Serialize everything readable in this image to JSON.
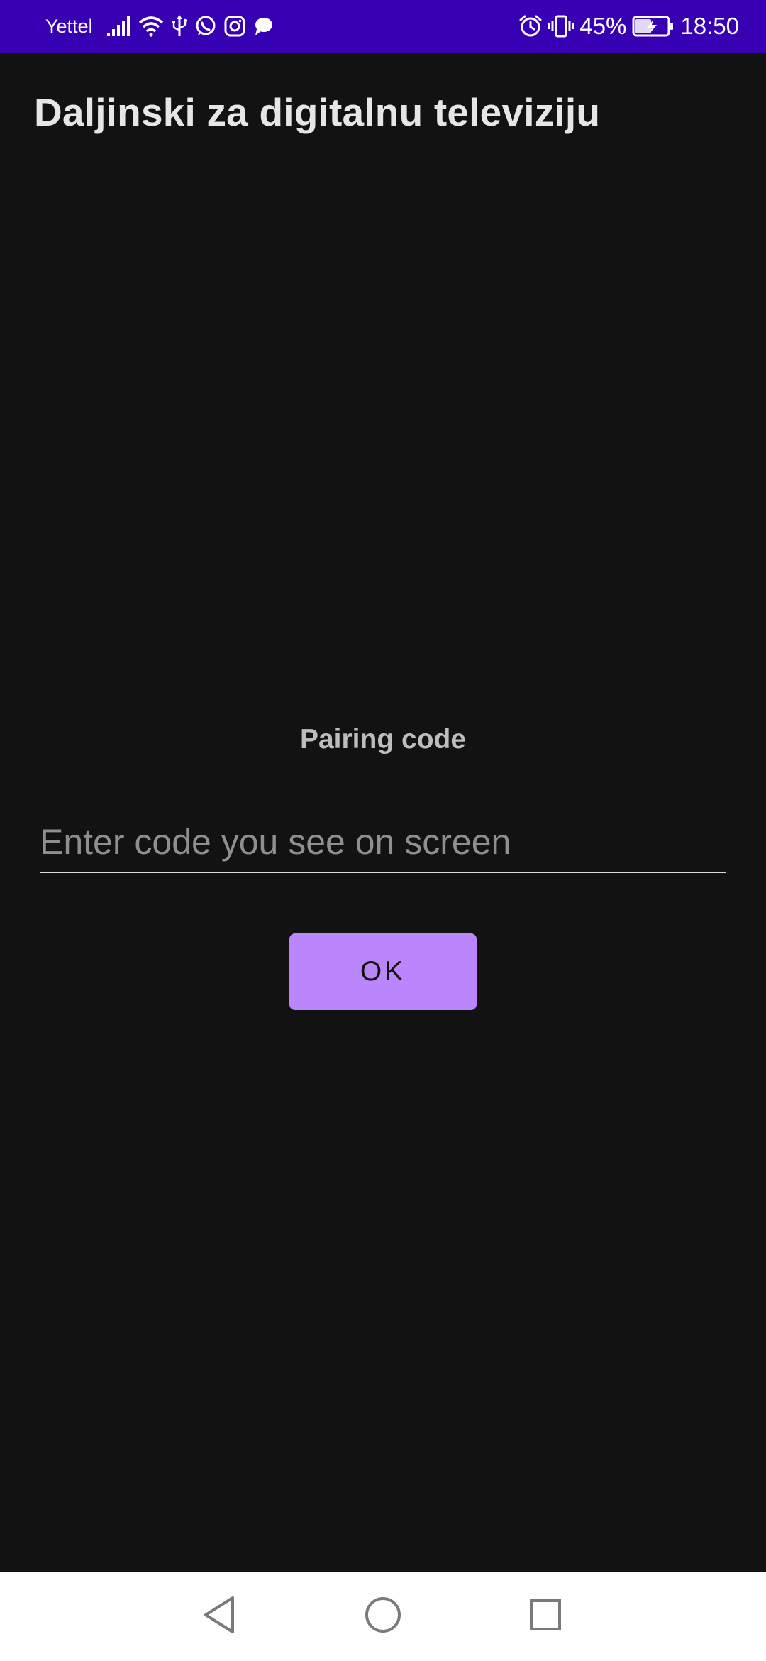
{
  "status_bar": {
    "carrier": "Yettel",
    "battery_percent": "45%",
    "time": "18:50",
    "background_color": "#3700b3",
    "icons": [
      "signal-icon",
      "wifi-icon",
      "usb-icon",
      "whatsapp-icon",
      "instagram-icon",
      "chat-icon",
      "alarm-icon",
      "vibrate-icon",
      "battery-charging-icon"
    ]
  },
  "app_bar": {
    "title": "Daljinski za digitalnu televiziju"
  },
  "pairing": {
    "label": "Pairing code",
    "input_value": "",
    "input_placeholder": "Enter code you see on screen",
    "ok_label": "OK",
    "accent_color": "#bb86fc"
  },
  "nav_bar": {
    "icons": [
      "back-icon",
      "home-icon",
      "recents-icon"
    ]
  }
}
